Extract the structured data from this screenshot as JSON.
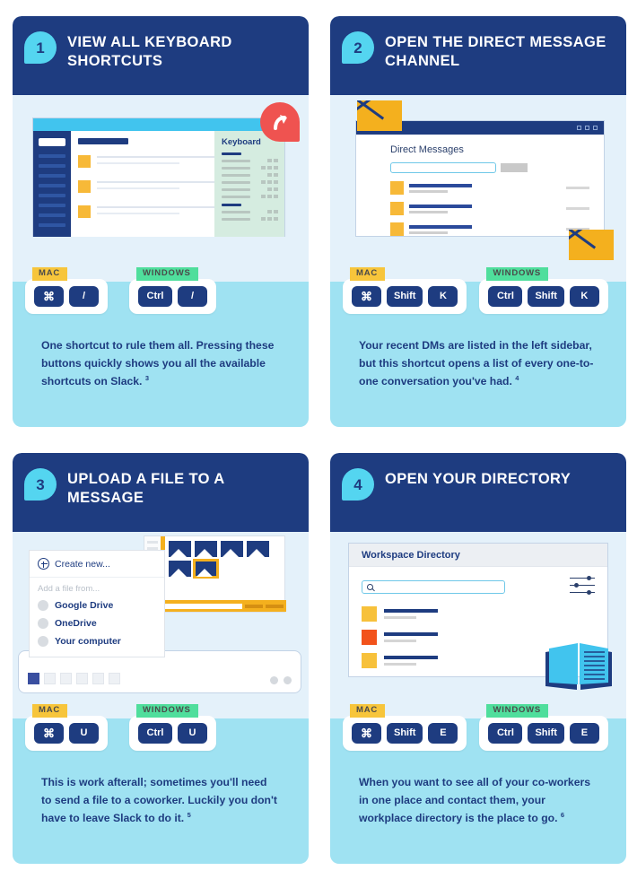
{
  "colors": {
    "header_navy": "#1e3c80",
    "badge_cyan": "#54d5f0",
    "strip_blue": "#9fe2f2",
    "illus_bg": "#e4f1fa",
    "mac_yellow": "#f7c53b",
    "windows_green": "#4fde9c",
    "accent_red": "#ef5350",
    "accent_orange": "#f2521b",
    "accent_amber": "#f7b938"
  },
  "cards": [
    {
      "step": "1",
      "title": "VIEW ALL KEYBOARD SHORTCUTS",
      "illustration": {
        "kind": "keyboard-shortcuts-window",
        "panel_title": "Keyboard",
        "badge_icon": "share-arrow-icon"
      },
      "shortcuts": {
        "mac_label": "MAC",
        "windows_label": "WINDOWS",
        "mac_keys": [
          "⌘",
          "/"
        ],
        "windows_keys": [
          "Ctrl",
          "/"
        ]
      },
      "body": "One shortcut to rule them all. Pressing these buttons quickly shows you all the available shortcuts on Slack.",
      "footnote": "3"
    },
    {
      "step": "2",
      "title": "OPEN THE DIRECT MESSAGE CHANNEL",
      "illustration": {
        "kind": "direct-messages-window",
        "panel_title": "Direct Messages",
        "badge_icon": "envelope-icon"
      },
      "shortcuts": {
        "mac_label": "MAC",
        "windows_label": "WINDOWS",
        "mac_keys": [
          "⌘",
          "Shift",
          "K"
        ],
        "windows_keys": [
          "Ctrl",
          "Shift",
          "K"
        ]
      },
      "body": "Your recent DMs are listed in the left sidebar, but this shortcut opens a list of every one-to-one conversation you've had.",
      "footnote": "4"
    },
    {
      "step": "3",
      "title": "UPLOAD A FILE TO A MESSAGE",
      "illustration": {
        "kind": "file-upload-menu",
        "menu_create": "Create  new...",
        "menu_subtitle": "Add a file from...",
        "menu_items": [
          "Google Drive",
          "OneDrive",
          "Your computer"
        ]
      },
      "shortcuts": {
        "mac_label": "MAC",
        "windows_label": "WINDOWS",
        "mac_keys": [
          "⌘",
          "U"
        ],
        "windows_keys": [
          "Ctrl",
          "U"
        ]
      },
      "body": "This is work afterall; sometimes you'll need to send a file to a coworker. Luckily you don't have to leave Slack to do it.",
      "footnote": "5"
    },
    {
      "step": "4",
      "title": "OPEN YOUR DIRECTORY",
      "illustration": {
        "kind": "workspace-directory-window",
        "panel_title": "Workspace Directory",
        "search_placeholder": "",
        "badge_icon": "open-book-icon"
      },
      "shortcuts": {
        "mac_label": "MAC",
        "windows_label": "WINDOWS",
        "mac_keys": [
          "⌘",
          "Shift",
          "E"
        ],
        "windows_keys": [
          "Ctrl",
          "Shift",
          "E"
        ]
      },
      "body": "When you want to see all of your co-workers in one place and contact them, your workplace directory is the place to go.",
      "footnote": "6"
    }
  ]
}
